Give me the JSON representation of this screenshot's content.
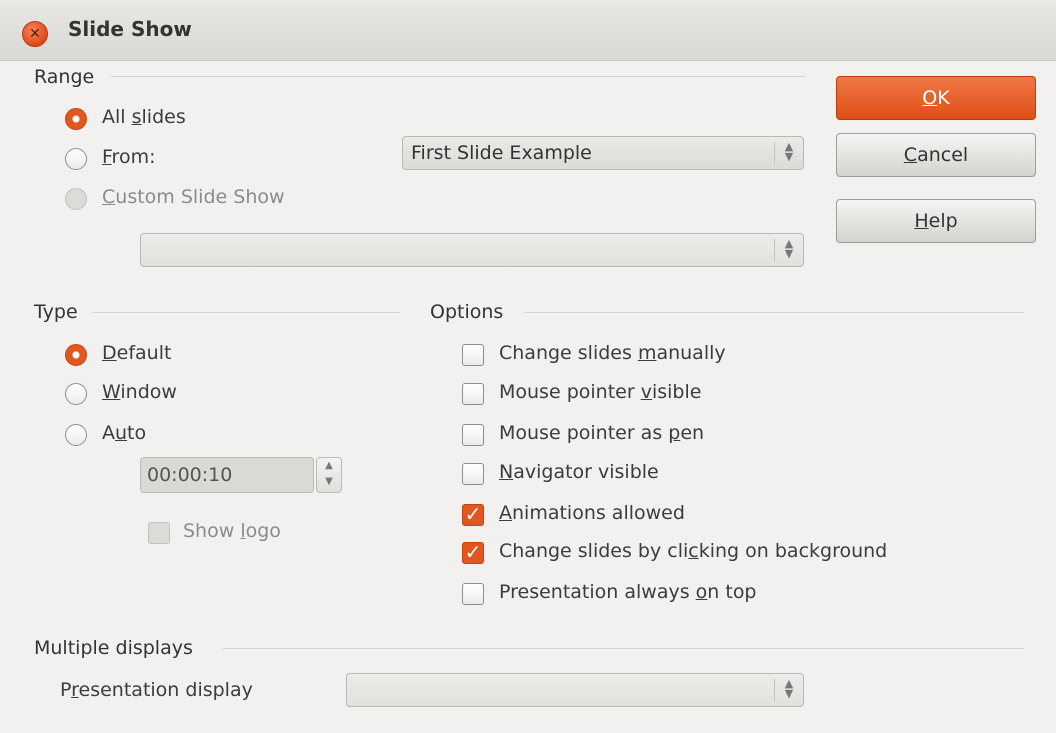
{
  "window": {
    "title": "Slide Show"
  },
  "range": {
    "heading": "Range",
    "all_slides": {
      "pre": "All ",
      "ul": "s",
      "post": "lides"
    },
    "from": {
      "pre": "",
      "ul": "F",
      "post": "rom:"
    },
    "from_select": "First Slide Example",
    "custom": {
      "pre": "",
      "ul": "C",
      "post": "ustom Slide Show"
    },
    "custom_select": ""
  },
  "type": {
    "heading": "Type",
    "default": {
      "pre": "",
      "ul": "D",
      "post": "efault"
    },
    "window": {
      "pre": "",
      "ul": "W",
      "post": "indow"
    },
    "auto": {
      "pre": "A",
      "ul": "u",
      "post": "to"
    },
    "pause": "00:00:10",
    "show_logo": {
      "pre": "Show ",
      "ul": "l",
      "post": "ogo"
    }
  },
  "options": {
    "heading": "Options",
    "items": [
      {
        "pre": "Change slides ",
        "ul": "m",
        "post": "anually",
        "checked": false
      },
      {
        "pre": "Mouse pointer ",
        "ul": "v",
        "post": "isible",
        "checked": false
      },
      {
        "pre": "Mouse pointer as ",
        "ul": "p",
        "post": "en",
        "checked": false
      },
      {
        "pre": "",
        "ul": "N",
        "post": "avigator visible",
        "checked": false
      },
      {
        "pre": "",
        "ul": "A",
        "post": "nimations allowed",
        "checked": true
      },
      {
        "pre": "Change slides by cli",
        "ul": "c",
        "post": "king on background",
        "checked": true
      },
      {
        "pre": "Presentation always ",
        "ul": "o",
        "post": "n top",
        "checked": false
      }
    ]
  },
  "displays": {
    "heading": "Multiple displays",
    "label": {
      "pre": "P",
      "ul": "r",
      "post": "esentation display"
    },
    "select": ""
  },
  "buttons": {
    "ok": {
      "pre": "",
      "ul": "O",
      "post": "K"
    },
    "cancel": {
      "pre": "",
      "ul": "C",
      "post": "ancel"
    },
    "help": {
      "pre": "",
      "ul": "H",
      "post": "elp"
    }
  },
  "colors": {
    "accent": "#e4561f",
    "background": "#f2f1f0"
  }
}
